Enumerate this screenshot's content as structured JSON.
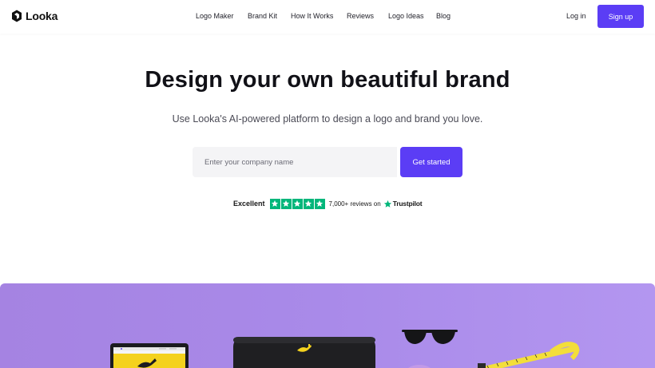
{
  "brand": {
    "name": "Looka",
    "accent": "#5b3df5"
  },
  "nav": {
    "items": [
      {
        "label": "Logo Maker"
      },
      {
        "label": "Brand Kit"
      },
      {
        "label": "How It Works"
      },
      {
        "label": "Reviews"
      },
      {
        "label": "Logo Ideas"
      },
      {
        "label": "Blog"
      }
    ],
    "login_label": "Log in",
    "signup_label": "Sign up"
  },
  "hero": {
    "title": "Design your own beautiful brand",
    "subtitle": "Use Looka's AI-powered platform to design a logo and brand you love.",
    "input_placeholder": "Enter your company name",
    "cta_label": "Get started"
  },
  "trustpilot": {
    "rating_word": "Excellent",
    "stars": 5,
    "reviews_text": "7,000+ reviews on",
    "brand": "Trustpilot",
    "star_color": "#00b67a"
  },
  "showcase": {
    "background": "#a98ae9",
    "items": [
      "tablet-icon",
      "pencil-case-icon",
      "sunglasses-icon",
      "measuring-tape-icon"
    ]
  }
}
